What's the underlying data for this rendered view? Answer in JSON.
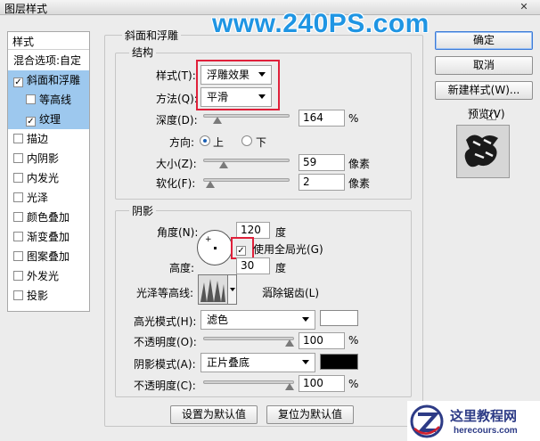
{
  "window": {
    "title": "图层样式",
    "close_glyph": "✕"
  },
  "watermark": "www.240PS.com",
  "left_panel": {
    "header": "样式",
    "items": [
      {
        "label": "混合选项:自定",
        "checkbox": false,
        "checked": false,
        "selected": false,
        "indent": false
      },
      {
        "label": "斜面和浮雕",
        "checkbox": true,
        "checked": true,
        "selected": true,
        "indent": false
      },
      {
        "label": "等高线",
        "checkbox": true,
        "checked": false,
        "selected": true,
        "indent": true
      },
      {
        "label": "纹理",
        "checkbox": true,
        "checked": true,
        "selected": true,
        "indent": true
      },
      {
        "label": "描边",
        "checkbox": true,
        "checked": false,
        "selected": false,
        "indent": false
      },
      {
        "label": "内阴影",
        "checkbox": true,
        "checked": false,
        "selected": false,
        "indent": false
      },
      {
        "label": "内发光",
        "checkbox": true,
        "checked": false,
        "selected": false,
        "indent": false
      },
      {
        "label": "光泽",
        "checkbox": true,
        "checked": false,
        "selected": false,
        "indent": false
      },
      {
        "label": "颜色叠加",
        "checkbox": true,
        "checked": false,
        "selected": false,
        "indent": false
      },
      {
        "label": "渐变叠加",
        "checkbox": true,
        "checked": false,
        "selected": false,
        "indent": false
      },
      {
        "label": "图案叠加",
        "checkbox": true,
        "checked": false,
        "selected": false,
        "indent": false
      },
      {
        "label": "外发光",
        "checkbox": true,
        "checked": false,
        "selected": false,
        "indent": false
      },
      {
        "label": "投影",
        "checkbox": true,
        "checked": false,
        "selected": false,
        "indent": false
      }
    ]
  },
  "bevel": {
    "group_title": "斜面和浮雕",
    "structure": {
      "title": "结构",
      "style_label": "样式(T):",
      "style_value": "浮雕效果",
      "method_label": "方法(Q):",
      "method_value": "平滑",
      "depth_label": "深度(D):",
      "depth_value": "164",
      "depth_unit": "%",
      "depth_level": 0.16,
      "direction_label": "方向:",
      "direction_up": "上",
      "direction_down": "下",
      "direction_selected": "上",
      "size_label": "大小(Z):",
      "size_value": "59",
      "size_unit": "像素",
      "size_level": 0.24,
      "soften_label": "软化(F):",
      "soften_value": "2",
      "soften_unit": "像素",
      "soften_level": 0.08
    },
    "shading": {
      "title": "阴影",
      "angle_label": "角度(N):",
      "angle_value": "120",
      "angle_unit": "度",
      "global_light_label": "使用全局光(G)",
      "global_light_checked": true,
      "altitude_label": "高度:",
      "altitude_value": "30",
      "altitude_unit": "度",
      "gloss_label": "光泽等高线:",
      "anti_alias_label": "消除锯齿(L)",
      "anti_alias_checked": false,
      "highlight_mode_label": "高光模式(H):",
      "highlight_mode_value": "滤色",
      "highlight_color": "#ffffff",
      "highlight_opacity_label": "不透明度(O):",
      "highlight_opacity_value": "100",
      "highlight_opacity_unit": "%",
      "shadow_mode_label": "阴影模式(A):",
      "shadow_mode_value": "正片叠底",
      "shadow_color": "#000000",
      "shadow_opacity_label": "不透明度(C):",
      "shadow_opacity_value": "100",
      "shadow_opacity_unit": "%"
    },
    "make_default": "设置为默认值",
    "reset_default": "复位为默认值"
  },
  "right_panel": {
    "ok": "确定",
    "cancel": "取消",
    "new_style": "新建样式(W)...",
    "preview_label": "预览(V)",
    "preview_checked": true
  },
  "logo": {
    "name": "这里教程网",
    "url": "herecours.com"
  },
  "colors": {
    "selection": "#9dc8ee",
    "highlight_box": "#e0203a",
    "watermark": "#1f95e3"
  }
}
